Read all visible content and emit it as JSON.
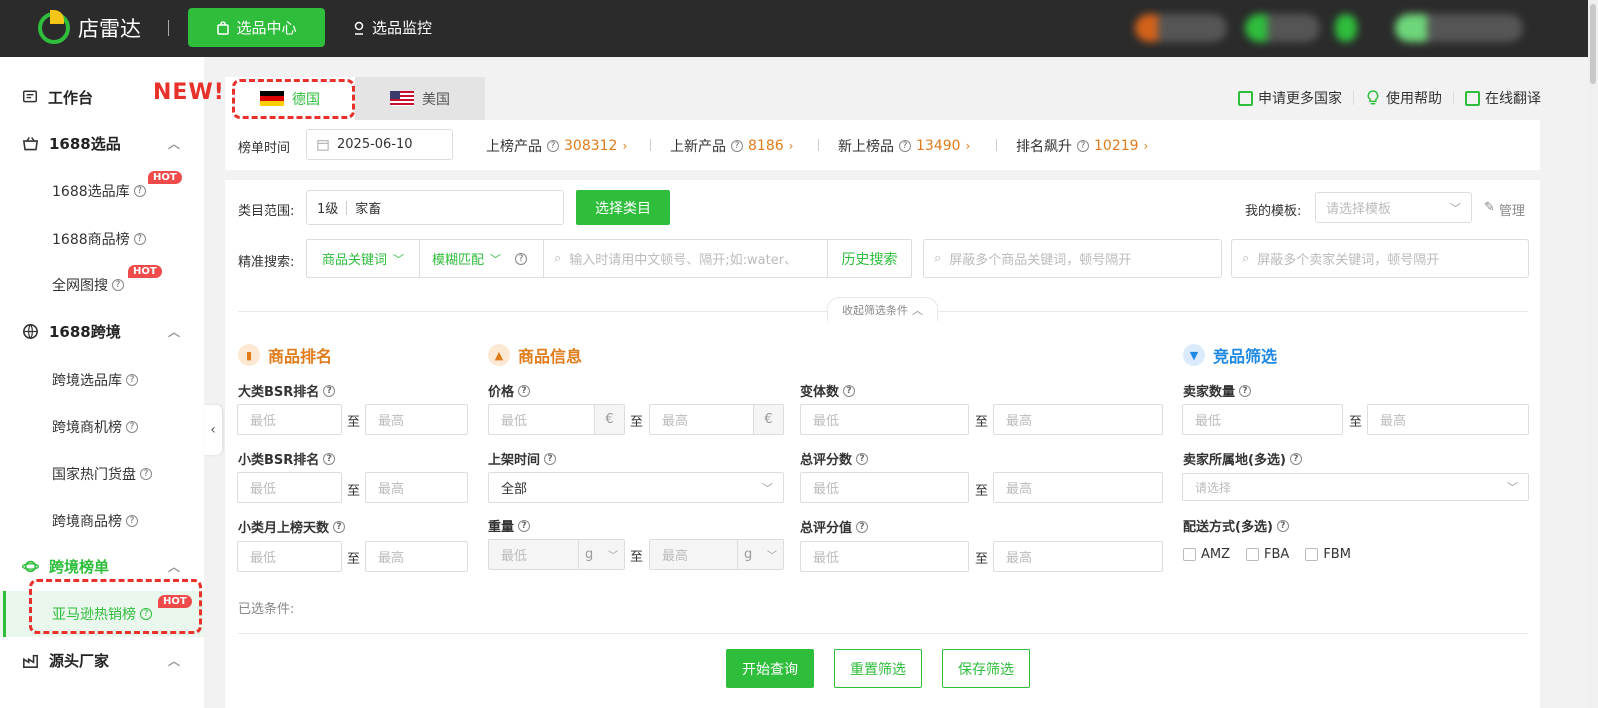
{
  "header": {
    "logo_text": "店雷达",
    "nav_active": "选品中心",
    "nav_link": "选品监控"
  },
  "sidebar": {
    "workbench": "工作台",
    "group1": {
      "title": "1688选品",
      "items": [
        "1688选品库",
        "1688商品榜",
        "全网图搜"
      ]
    },
    "group2": {
      "title": "1688跨境",
      "items": [
        "跨境选品库",
        "跨境商机榜",
        "国家热门货盘",
        "跨境商品榜"
      ]
    },
    "group3": {
      "title": "跨境榜单",
      "items": [
        "亚马逊热销榜"
      ]
    },
    "group4": {
      "title": "源头厂家"
    },
    "hot_label": "HOT",
    "help_glyph": "?"
  },
  "new_label": "NEW!",
  "tabs": [
    {
      "label": "德国",
      "active": true
    },
    {
      "label": "美国",
      "active": false
    }
  ],
  "top_actions": {
    "apply": "申请更多国家",
    "help": "使用帮助",
    "translate": "在线翻译"
  },
  "stats": {
    "time_label": "榜单时间",
    "date": "2025-06-10",
    "items": [
      {
        "label": "上榜产品",
        "value": "308312"
      },
      {
        "label": "上新产品",
        "value": "8186"
      },
      {
        "label": "新上榜品",
        "value": "13490"
      },
      {
        "label": "排名飙升",
        "value": "10219"
      }
    ]
  },
  "filter": {
    "category_label": "类目范围:",
    "category_level": "1级",
    "category_value": "家畜",
    "select_category": "选择类目",
    "template_label": "我的模板:",
    "template_placeholder": "请选择模板",
    "manage": "管理",
    "search_label": "精准搜索:",
    "keyword_type": "商品关键词",
    "match_type": "模糊匹配",
    "search_placeholder": "输入时请用中文顿号、隔开;如:water、",
    "history": "历史搜索",
    "exclude_product_placeholder": "屏蔽多个商品关键词，顿号隔开",
    "exclude_seller_placeholder": "屏蔽多个卖家关键词，顿号隔开",
    "collapse": "收起筛选条件"
  },
  "sections": {
    "rank": {
      "title": "商品排名",
      "fields": [
        "大类BSR排名",
        "小类BSR排名",
        "小类月上榜天数"
      ]
    },
    "info": {
      "title": "商品信息",
      "fields": [
        "价格",
        "上架时间",
        "重量",
        "变体数",
        "总评分数",
        "总评分值"
      ],
      "listing_value": "全部"
    },
    "compete": {
      "title": "竞品筛选",
      "fields": [
        "卖家数量",
        "卖家所属地(多选)",
        "配送方式(多选)"
      ],
      "location_placeholder": "请选择",
      "shipping": [
        "AMZ",
        "FBA",
        "FBM"
      ]
    }
  },
  "placeholders": {
    "min": "最低",
    "max": "最高",
    "to": "至",
    "currency": "€",
    "weight_unit": "g"
  },
  "selected_label": "已选条件:",
  "buttons": {
    "query": "开始查询",
    "reset": "重置筛选",
    "save": "保存筛选"
  },
  "colors": {
    "brand": "#2fbd3c",
    "accent": "#e07b1a",
    "highlight": "#e8312a",
    "blue": "#1e88e5"
  }
}
